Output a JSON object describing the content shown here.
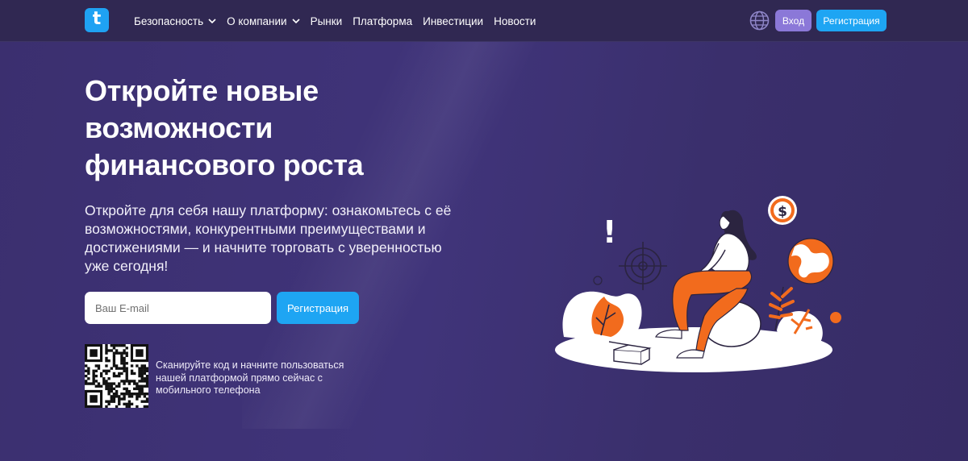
{
  "header": {
    "logo_letter": "t",
    "nav": [
      {
        "label": "Безопасность",
        "has_dropdown": true
      },
      {
        "label": "О компании",
        "has_dropdown": true
      },
      {
        "label": "Рынки",
        "has_dropdown": false
      },
      {
        "label": "Платформа",
        "has_dropdown": false
      },
      {
        "label": "Инвестиции",
        "has_dropdown": false
      },
      {
        "label": "Новости",
        "has_dropdown": false
      }
    ],
    "language_icon": "globe-icon",
    "login_label": "Вход",
    "register_label": "Регистрация"
  },
  "hero": {
    "title": "Откройте новые возможности финансового роста",
    "subtitle": "Откройте для себя нашу платформу: ознакомьтесь с её возможностями, конкурентными преимуществами и достижениями — и начните торговать с уверенностью уже сегодня!",
    "email_placeholder": "Ваш E-mail",
    "email_value": "",
    "register_label": "Регистрация",
    "qr_text": "Сканируйте код и начните пользоваться нашей платформой прямо сейчас с мобильного телефона",
    "illustration": {
      "exclamation": "!",
      "coin_symbol": "$"
    }
  },
  "colors": {
    "background": "#3a2f6e",
    "topbar": "#302852",
    "accent_blue": "#1ea5f3",
    "login_purple": "#8b78d8",
    "illustration_orange": "#f26b1d"
  }
}
